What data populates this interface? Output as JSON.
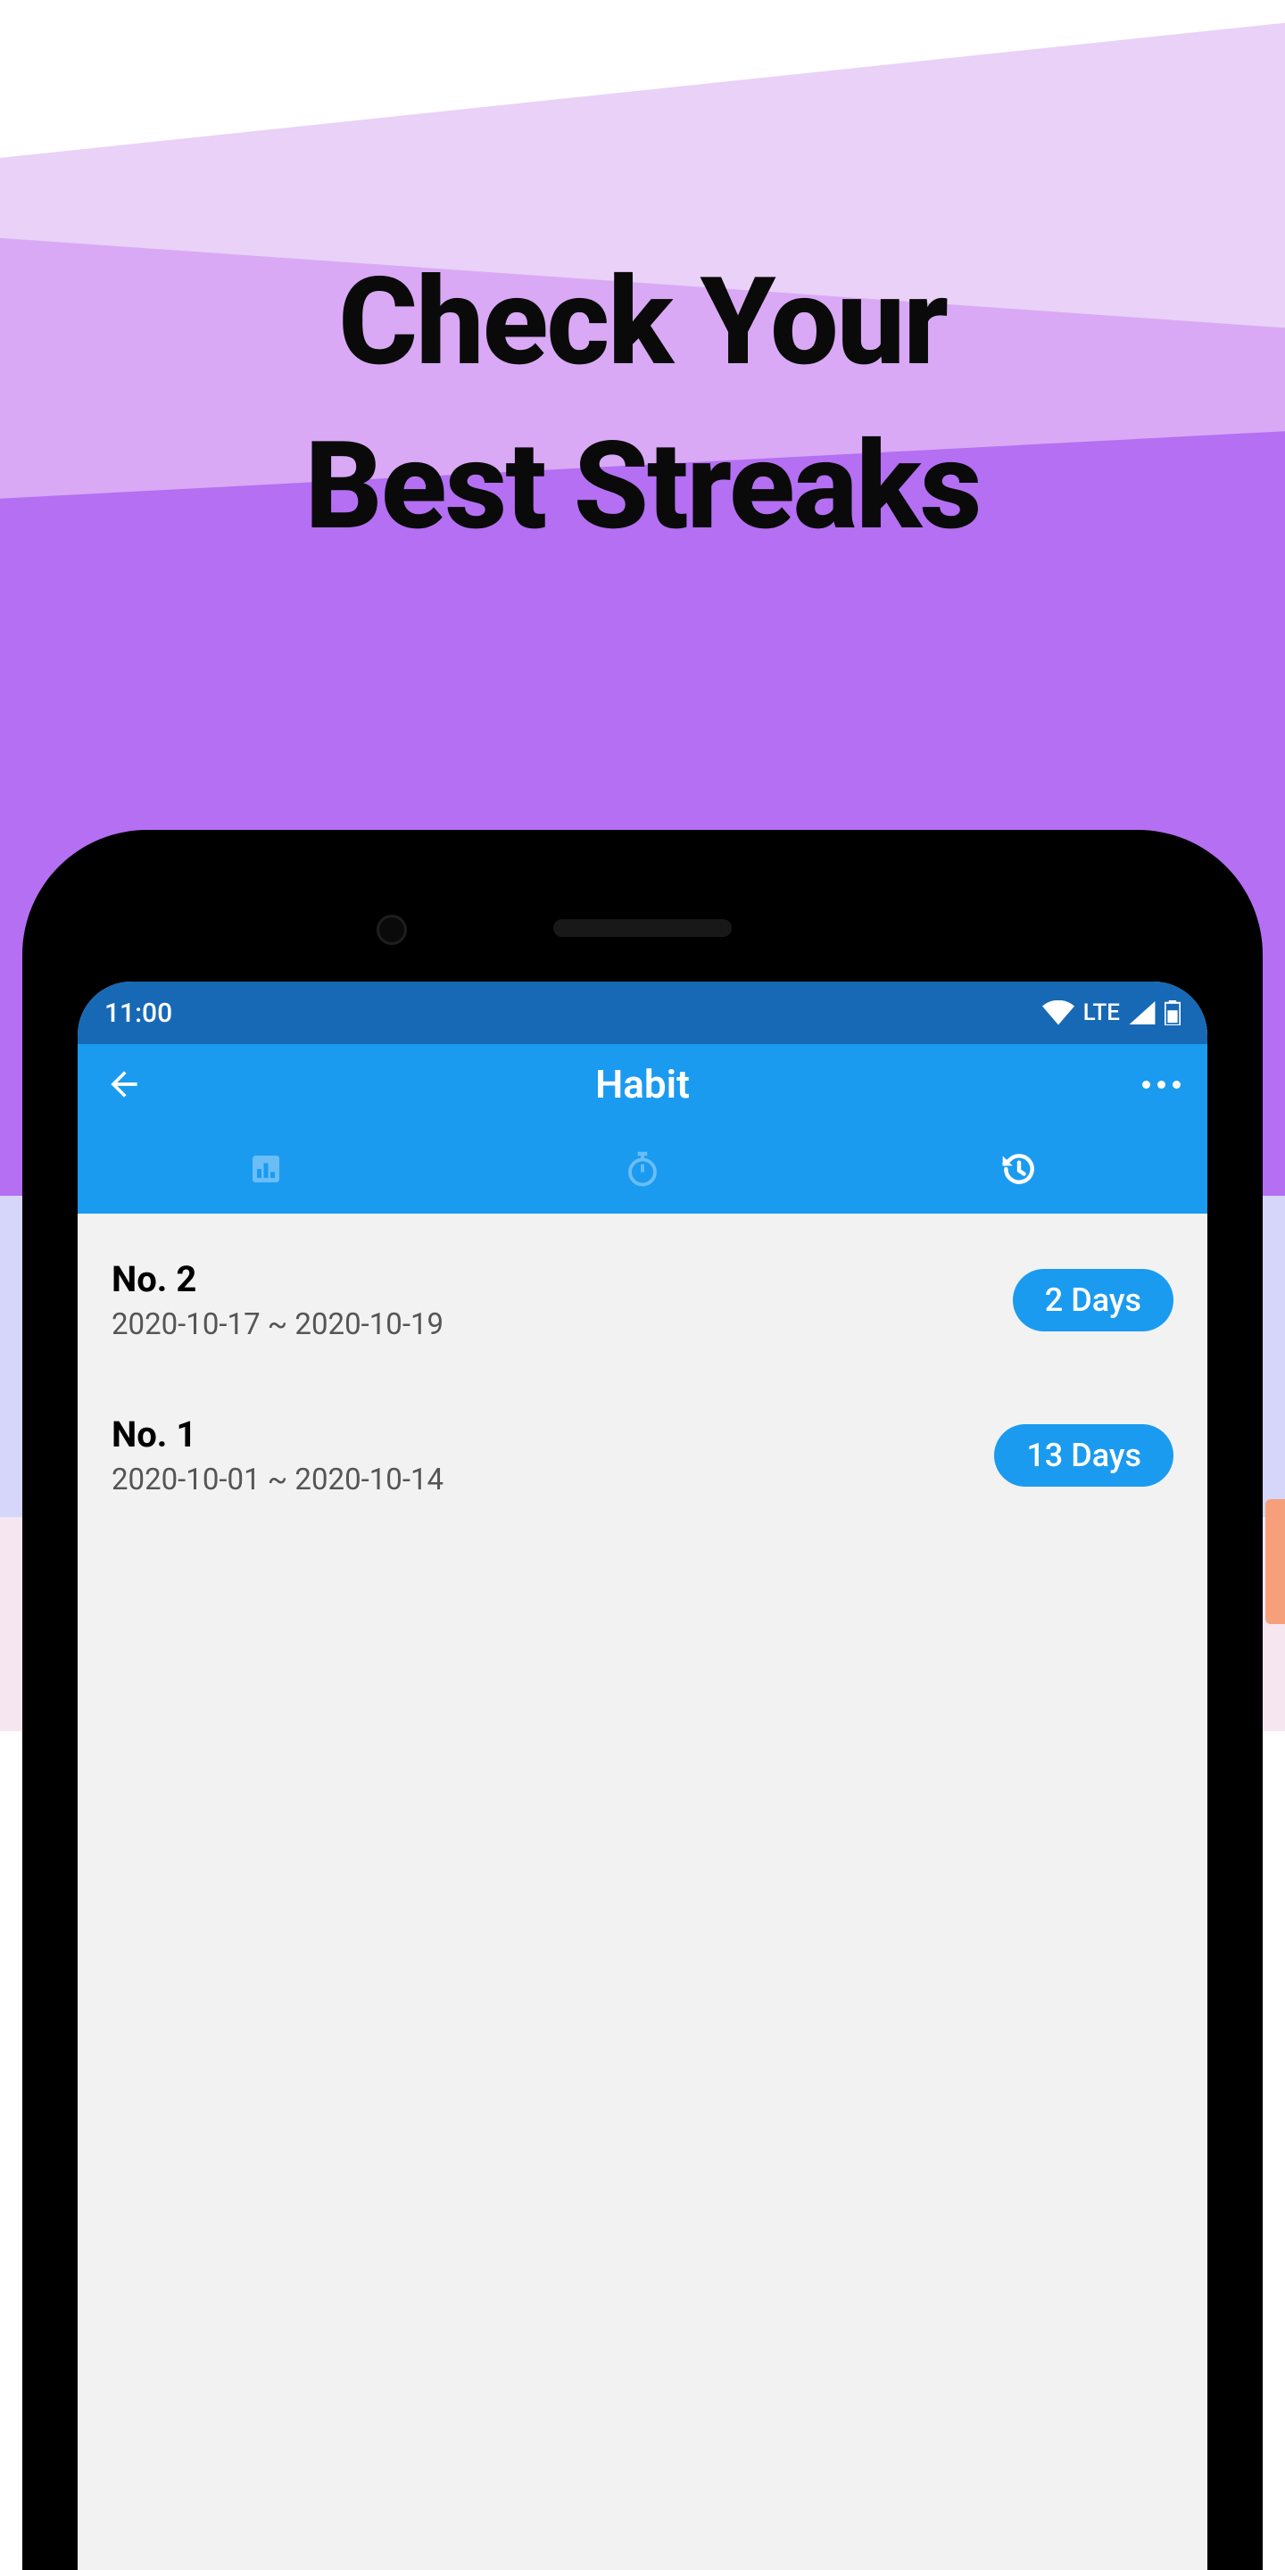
{
  "promo": {
    "line1": "Check Your",
    "line2": "Best Streaks"
  },
  "status": {
    "time": "11:00",
    "network": "LTE"
  },
  "app": {
    "title": "Habit"
  },
  "tabs": {
    "stats": "stats",
    "timer": "timer",
    "history": "history"
  },
  "streaks": [
    {
      "rank": "No. 2",
      "dates": "2020-10-17 ~ 2020-10-19",
      "duration": "2 Days"
    },
    {
      "rank": "No. 1",
      "dates": "2020-10-01 ~ 2020-10-14",
      "duration": "13 Days"
    }
  ]
}
